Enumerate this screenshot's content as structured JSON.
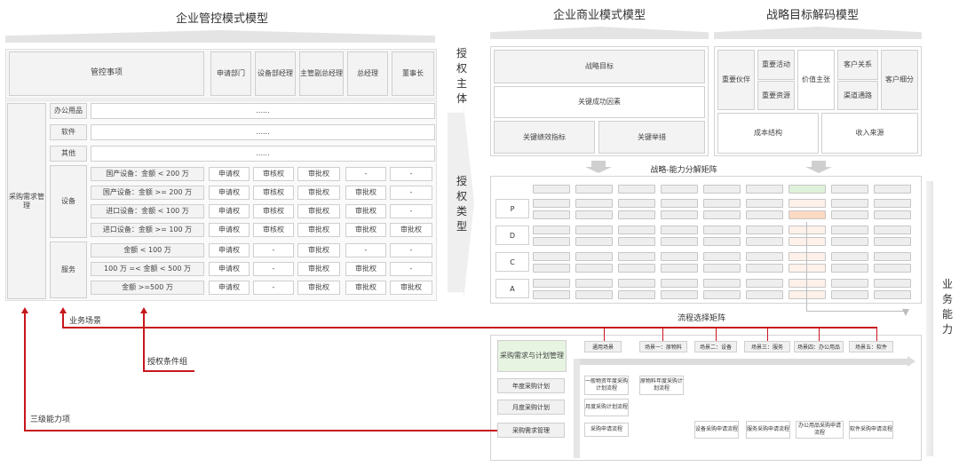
{
  "titles": {
    "control": "企业管控模式模型",
    "business": "企业商业模式模型",
    "strategy": "战略目标解码模型",
    "matrix": "战略-能力分解矩阵",
    "process_matrix": "流程选择矩阵"
  },
  "side_labels": {
    "auth_subject": [
      "授",
      "权",
      "主",
      "体"
    ],
    "auth_type": [
      "授",
      "权",
      "类",
      "型"
    ],
    "business_ability": [
      "业",
      "务",
      "能",
      "力"
    ]
  },
  "control_table": {
    "header_item": "管控事项",
    "header_roles": [
      "申请部门",
      "设备部经理",
      "主管副总经理",
      "总经理",
      "董事长"
    ],
    "left_block": "采购需求管理",
    "dots": "......",
    "simple_rows": [
      "办公用品",
      "软件",
      "其他"
    ],
    "groups": [
      {
        "name": "设备",
        "rows": [
          {
            "cond": "国产设备：金额 < 200 万",
            "cells": [
              "申请权",
              "审核权",
              "审批权",
              "-",
              "-"
            ]
          },
          {
            "cond": "国产设备：金额 >= 200 万",
            "cells": [
              "申请权",
              "审核权",
              "审批权",
              "审批权",
              "-"
            ]
          },
          {
            "cond": "进口设备：金额 < 100 万",
            "cells": [
              "申请权",
              "审核权",
              "审批权",
              "审批权",
              "-"
            ]
          },
          {
            "cond": "进口设备：金额 >= 100 万",
            "cells": [
              "申请权",
              "审核权",
              "审批权",
              "审批权",
              "审批权"
            ]
          }
        ]
      },
      {
        "name": "服务",
        "rows": [
          {
            "cond": "金额 < 100 万",
            "cells": [
              "申请权",
              "-",
              "审批权",
              "-",
              "-"
            ]
          },
          {
            "cond": "100 万 =< 金额 < 500 万",
            "cells": [
              "申请权",
              "-",
              "审批权",
              "审批权",
              "-"
            ]
          },
          {
            "cond": "金额 >=500 万",
            "cells": [
              "申请权",
              "-",
              "审批权",
              "审批权",
              "审批权"
            ]
          }
        ]
      }
    ]
  },
  "annotations": {
    "business_scenario": "业务场景",
    "auth_condition": "授权条件组",
    "level3": "三级能力项"
  },
  "business_model": {
    "goal": "战略目标",
    "csf": "关键成功因素",
    "kpi": "关键绩效指标",
    "measures": "关键举措"
  },
  "strategy_model": {
    "partners": "重要伙伴",
    "activities": "重要活动",
    "resources": "重要资源",
    "value": "价值主张",
    "relations": "客户关系",
    "channels": "渠道通路",
    "segments": "客户细分",
    "cost": "成本结构",
    "revenue": "收入来源"
  },
  "matrix": {
    "rows": [
      "P",
      "D",
      "C",
      "A"
    ]
  },
  "process": {
    "scenarios": [
      "通用场景",
      "场景一：原物料",
      "场景二：设备",
      "场景三：服务",
      "场景四：办公用品",
      "场景五：软件"
    ],
    "main": "采购需求与计划管理",
    "subs": [
      "年度采购计划",
      "月度采购计划",
      "采购需求管理"
    ],
    "flows": {
      "general_annual": "一般物资年度采购计划流程",
      "raw_annual": "原物料年度采购计划流程",
      "monthly": "月度采购计划流程",
      "request": "采购申请流程",
      "equipment": "设备采购申请流程",
      "service": "服务采购申请流程",
      "office": "办公用品采购申请流程",
      "software": "软件采购申请流程"
    }
  },
  "colors": {
    "accent_red": "#c8161d",
    "highlight_green": "#dff1da",
    "highlight_orange": "#fcd9c2",
    "cell_gray": "#f3f3f3"
  }
}
